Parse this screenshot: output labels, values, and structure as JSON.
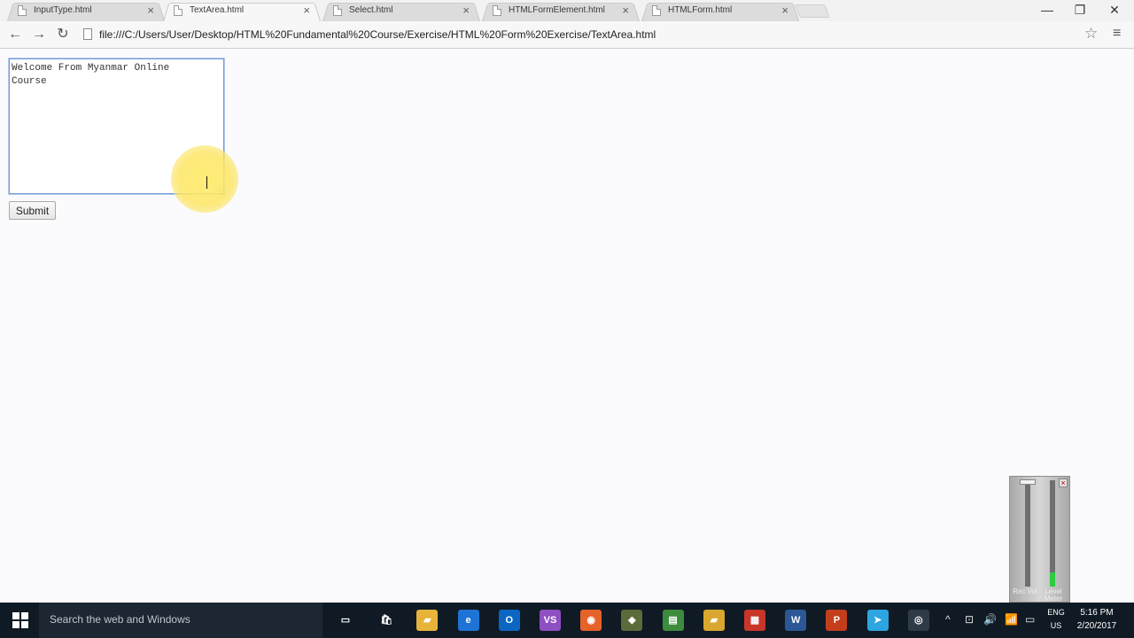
{
  "tabs": [
    {
      "title": "InputType.html",
      "active": false
    },
    {
      "title": "TextArea.html",
      "active": true
    },
    {
      "title": "Select.html",
      "active": false
    },
    {
      "title": "HTMLFormElement.html",
      "active": false
    },
    {
      "title": "HTMLForm.html",
      "active": false
    }
  ],
  "tab_close_glyph": "×",
  "window_controls": {
    "minimize": "—",
    "restore": "❐",
    "close": "✕"
  },
  "toolbar": {
    "back": "←",
    "forward": "→",
    "reload": "↻",
    "url": "file:///C:/Users/User/Desktop/HTML%20Fundamental%20Course/Exercise/HTML%20Form%20Exercise/TextArea.html",
    "star": "☆",
    "menu": "≡"
  },
  "page": {
    "textarea_value": "Welcome From Myanmar Online\nCourse",
    "submit_label": "Submit"
  },
  "volume_widget": {
    "close": "×",
    "label_left": "Rec Vol",
    "label_right": "Level Meter"
  },
  "taskbar": {
    "search_placeholder": "Search the web and Windows",
    "apps": [
      {
        "name": "task-view",
        "glyph": "▭",
        "color": "#101a24"
      },
      {
        "name": "store",
        "glyph": "🛍",
        "color": "#101a24"
      },
      {
        "name": "file-explorer",
        "glyph": "▰",
        "color": "#e8b33a"
      },
      {
        "name": "edge",
        "glyph": "e",
        "color": "#1d74d6"
      },
      {
        "name": "outlook",
        "glyph": "O",
        "color": "#0b66c2"
      },
      {
        "name": "visual-studio",
        "glyph": "VS",
        "color": "#8e4fc2"
      },
      {
        "name": "firefox",
        "glyph": "◉",
        "color": "#e5622a"
      },
      {
        "name": "app-diamond",
        "glyph": "◆",
        "color": "#5b6b3a"
      },
      {
        "name": "app-green",
        "glyph": "▤",
        "color": "#3d8b3d"
      },
      {
        "name": "folder",
        "glyph": "▰",
        "color": "#d9a72f"
      },
      {
        "name": "app-grid",
        "glyph": "▦",
        "color": "#c8362a"
      },
      {
        "name": "word",
        "glyph": "W",
        "color": "#2b5797"
      },
      {
        "name": "powerpoint",
        "glyph": "P",
        "color": "#c43e1c"
      },
      {
        "name": "telegram",
        "glyph": "➤",
        "color": "#2ca5e0"
      },
      {
        "name": "chrome",
        "glyph": "◎",
        "color": "#2f3b46"
      }
    ],
    "tray_glyphs": [
      "^",
      "⊡",
      "🔊",
      "📶",
      "▭"
    ],
    "language": "ENG",
    "region": "US",
    "time": "5:16 PM",
    "date": "2/20/2017"
  }
}
